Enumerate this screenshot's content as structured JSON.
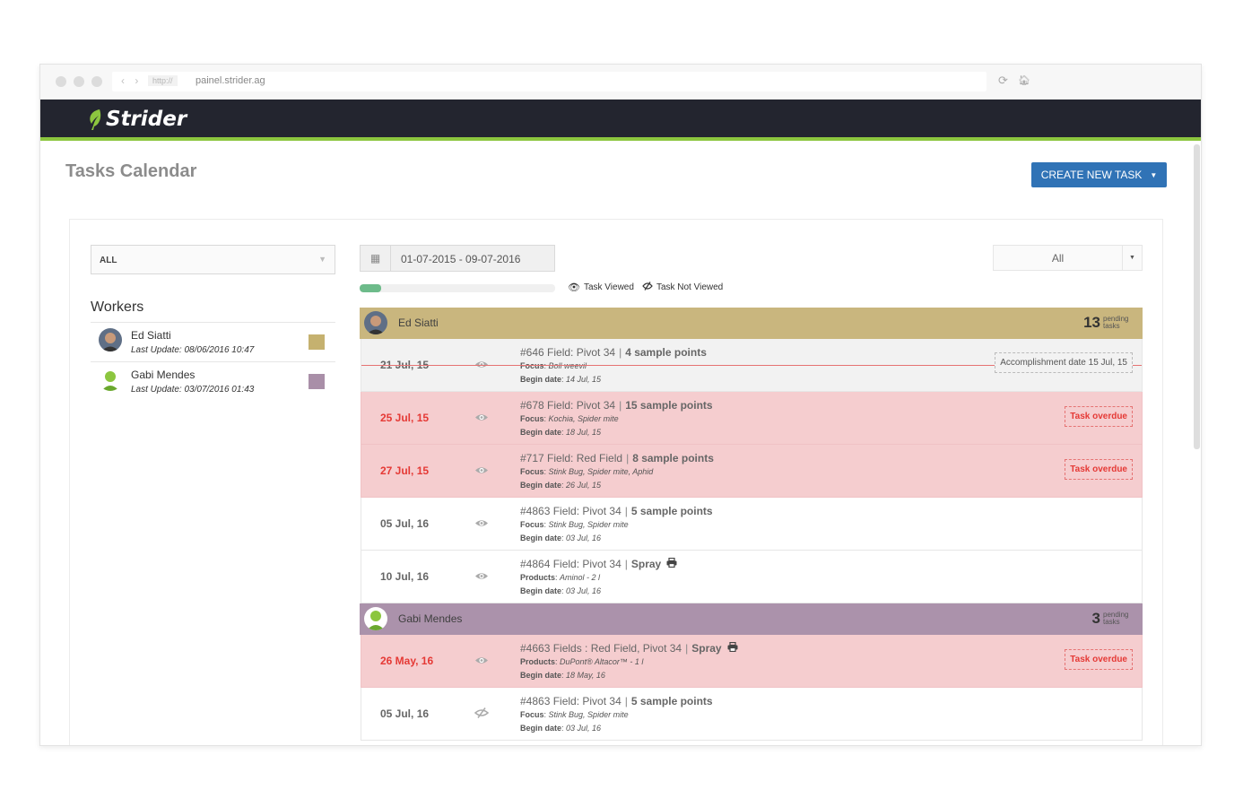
{
  "browser": {
    "protocol": "http://",
    "url": "painel.strider.ag",
    "reload_icon": "reload-icon",
    "home_icon": "home-icon"
  },
  "app": {
    "logo_text": "Strider",
    "brand_color": "#8cc63f",
    "topbar_color": "#23252f"
  },
  "page": {
    "title": "Tasks Calendar",
    "create_button": "CREATE NEW TASK"
  },
  "filters": {
    "worker_select": "ALL",
    "date_range": "01-07-2015 - 09-07-2016",
    "status_select": "All",
    "progress_fraction": 0.11
  },
  "legend": {
    "viewed": "Task Viewed",
    "not_viewed": "Task Not Viewed"
  },
  "workers": {
    "title": "Workers",
    "items": [
      {
        "name": "Ed Siatti",
        "last_update": "Last Update: 08/06/2016 10:47",
        "color": "#c5b16f"
      },
      {
        "name": "Gabi Mendes",
        "last_update": "Last Update: 03/07/2016 01:43",
        "color": "#a98fa8"
      }
    ]
  },
  "groups": [
    {
      "name": "Ed Siatti",
      "count": "13",
      "count_label_1": "pending",
      "count_label_2": "tasks",
      "color": "#c9b67e",
      "tasks": [
        {
          "state": "done",
          "date": "21 Jul, 15",
          "viewed": true,
          "title": "#646 Field: Pivot 34",
          "detail": "4 sample points",
          "line2_label": "Focus",
          "line2_value": "Boll weevil",
          "line3_label": "Begin date",
          "line3_value": "14 Jul, 15",
          "badge": "Accomplishment date 15 Jul, 15"
        },
        {
          "state": "overdue",
          "date": "25 Jul, 15",
          "viewed": true,
          "title": "#678 Field: Pivot 34",
          "detail": "15 sample points",
          "line2_label": "Focus",
          "line2_value": "Kochia, Spider mite",
          "line3_label": "Begin date",
          "line3_value": "18 Jul, 15",
          "badge": "Task overdue"
        },
        {
          "state": "overdue",
          "date": "27 Jul, 15",
          "viewed": true,
          "title": "#717 Field: Red Field",
          "detail": "8 sample points",
          "line2_label": "Focus",
          "line2_value": "Stink Bug, Spider mite, Aphid",
          "line3_label": "Begin date",
          "line3_value": "26 Jul, 15",
          "badge": "Task overdue"
        },
        {
          "state": "normal",
          "date": "05 Jul, 16",
          "viewed": true,
          "title": "#4863 Field: Pivot 34",
          "detail": "5 sample points",
          "line2_label": "Focus",
          "line2_value": "Stink Bug, Spider mite",
          "line3_label": "Begin date",
          "line3_value": "03 Jul, 16",
          "badge": ""
        },
        {
          "state": "normal",
          "date": "10 Jul, 16",
          "viewed": true,
          "title": "#4864 Field: Pivot 34",
          "detail": "Spray",
          "printable": true,
          "line2_label": "Products",
          "line2_value": "Aminol - 2 l",
          "line3_label": "Begin date",
          "line3_value": "03 Jul, 16",
          "badge": ""
        }
      ]
    },
    {
      "name": "Gabi Mendes",
      "count": "3",
      "count_label_1": "pending",
      "count_label_2": "tasks",
      "color": "#ab92ab",
      "tasks": [
        {
          "state": "overdue",
          "date": "26 May, 16",
          "viewed": true,
          "title": "#4663 Fields : Red Field, Pivot 34",
          "detail": "Spray",
          "printable": true,
          "line2_label": "Products",
          "line2_value": "DuPont® Altacor™ - 1 l",
          "line3_label": "Begin date",
          "line3_value": "18 May, 16",
          "badge": "Task overdue"
        },
        {
          "state": "normal",
          "date": "05 Jul, 16",
          "viewed": false,
          "title": "#4863 Field: Pivot 34",
          "detail": "5 sample points",
          "line2_label": "Focus",
          "line2_value": "Stink Bug, Spider mite",
          "line3_label": "Begin date",
          "line3_value": "03 Jul, 16",
          "badge": ""
        }
      ]
    }
  ]
}
